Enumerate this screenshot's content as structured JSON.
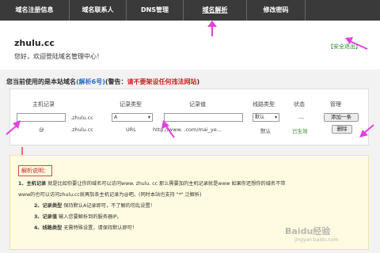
{
  "nav": {
    "tabs": [
      "域名注册信息",
      "域名联系人",
      "DNS管理",
      "域名解析",
      "修改密码"
    ]
  },
  "header": {
    "site": "zhulu.cc",
    "welcome": "您好，欢迎登陆域名管理中心！",
    "logout": "【安全退出】"
  },
  "warning": {
    "prefix": "您当前使用的是本站域名",
    "parse_count": "(解析6号)",
    "warn_prefix": "(警告：",
    "warn_text": "请不要架设任何违法网站",
    "warn_suffix": ")"
  },
  "table": {
    "headers": [
      "主机记录",
      "记录类型",
      "记录值",
      "线路类型",
      "状态",
      "管理"
    ],
    "input_row": {
      "domain_suffix": ".zhulu.cc",
      "type_value": "A",
      "line_value": "默认",
      "status": "---",
      "add_button": "添加一条"
    },
    "rows": [
      {
        "host": "@",
        "domain_suffix": ".zhulu.cc",
        "type": "URL",
        "value": "http://www.            .com/mai_ye...",
        "line": "默认",
        "status": "已生效",
        "delete_button": "删除"
      }
    ]
  },
  "note": {
    "title": "解析说明：",
    "lines": [
      {
        "label": "1、主机记录",
        "text": "就是比如你要让你的域名可以访问www. zhulu. cc 那么需要加的主机记录就是www 如果你还想你的域名不带"
      },
      {
        "label": "",
        "text": "www的也可以访问zhulu.cc就再加条主机记录为@吧。(同时本站也支持 \"*\" 泛解析)"
      },
      {
        "label": "2、记录类型",
        "text": "保持默认A记录即可，不了解的勿乱设置！"
      },
      {
        "label": "3、记录值",
        "text": "输入您要解析到的服务器IP。"
      },
      {
        "label": "4、线路类型",
        "text": "无需特殊设置，请保持默认即可！"
      }
    ]
  },
  "watermark": {
    "main": "Baidu经验",
    "sub": "jingyan.baidu.com"
  },
  "colors": {
    "nav_bg": "#3a3a3a",
    "accent_blue": "#2a6cc9",
    "warn_red": "#d42020",
    "ok_green": "#2f8a2f",
    "annotation_magenta": "#e040e0",
    "note_bg": "#fffbe0"
  }
}
